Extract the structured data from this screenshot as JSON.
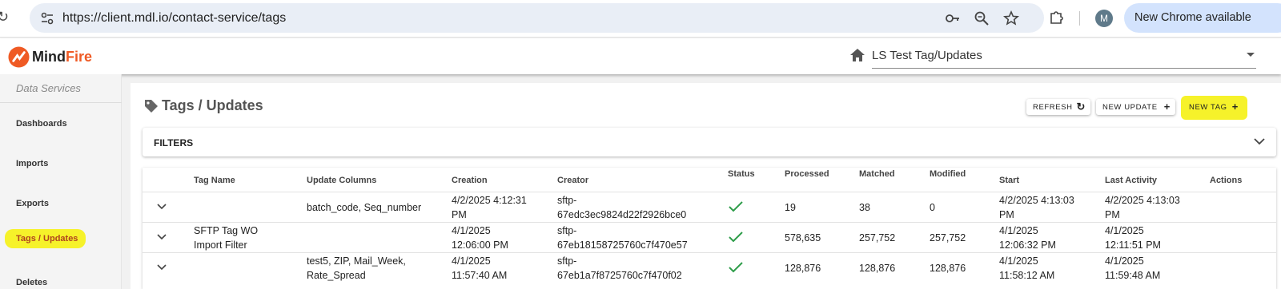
{
  "browser": {
    "url": "https://client.mdl.io/contact-service/tags",
    "profile_initial": "M",
    "new_chrome_label": "New Chrome available"
  },
  "app": {
    "brand_mind": "Mind",
    "brand_fire": "Fire",
    "project_selected": "LS Test Tag/Updates"
  },
  "sidebar": {
    "title": "Data Services",
    "items": [
      {
        "label": "Dashboards"
      },
      {
        "label": "Imports"
      },
      {
        "label": "Exports"
      },
      {
        "label": "Tags / Updates"
      },
      {
        "label": "Deletes"
      }
    ]
  },
  "page": {
    "title": "Tags / Updates",
    "refresh_label": "REFRESH",
    "new_update_label": "NEW UPDATE",
    "new_tag_label": "NEW TAG",
    "filters_label": "FILTERS"
  },
  "table": {
    "headers": {
      "tag_name": "Tag Name",
      "update_columns": "Update Columns",
      "creation": "Creation",
      "creator": "Creator",
      "status": "Status",
      "processed": "Processed",
      "matched": "Matched",
      "modified": "Modified",
      "start": "Start",
      "last_activity": "Last Activity",
      "actions": "Actions"
    },
    "rows": [
      {
        "tag_name_1": "",
        "tag_name_2": "",
        "update_columns_1": "batch_code, Seq_number",
        "update_columns_2": "",
        "creation_1": "4/2/2025 4:12:31",
        "creation_2": "PM",
        "creator_1": "sftp-",
        "creator_2": "67edc3ec9824d22f2926bce0",
        "processed": "19",
        "matched": "38",
        "modified": "0",
        "start_1": "4/2/2025 4:13:03",
        "start_2": "PM",
        "last_1": "4/2/2025 4:13:03",
        "last_2": "PM"
      },
      {
        "tag_name_1": "SFTP Tag WO",
        "tag_name_2": "Import Filter",
        "update_columns_1": "",
        "update_columns_2": "",
        "creation_1": "4/1/2025",
        "creation_2": "12:06:00 PM",
        "creator_1": "sftp-",
        "creator_2": "67eb18158725760c7f470e57",
        "processed": "578,635",
        "matched": "257,752",
        "modified": "257,752",
        "start_1": "4/1/2025",
        "start_2": "12:06:32 PM",
        "last_1": "4/1/2025",
        "last_2": "12:11:51 PM"
      },
      {
        "tag_name_1": "",
        "tag_name_2": "",
        "update_columns_1": "test5, ZIP, Mail_Week,",
        "update_columns_2": "Rate_Spread",
        "creation_1": "4/1/2025",
        "creation_2": "11:57:40 AM",
        "creator_1": "sftp-",
        "creator_2": "67eb1a7f8725760c7f470f02",
        "processed": "128,876",
        "matched": "128,876",
        "modified": "128,876",
        "start_1": "4/1/2025",
        "start_2": "11:58:12 AM",
        "last_1": "4/1/2025",
        "last_2": "11:59:48 AM"
      }
    ]
  },
  "colors": {
    "brand": "#ef5a24",
    "highlight": "#f6f22a",
    "success": "#2e9d4a"
  }
}
